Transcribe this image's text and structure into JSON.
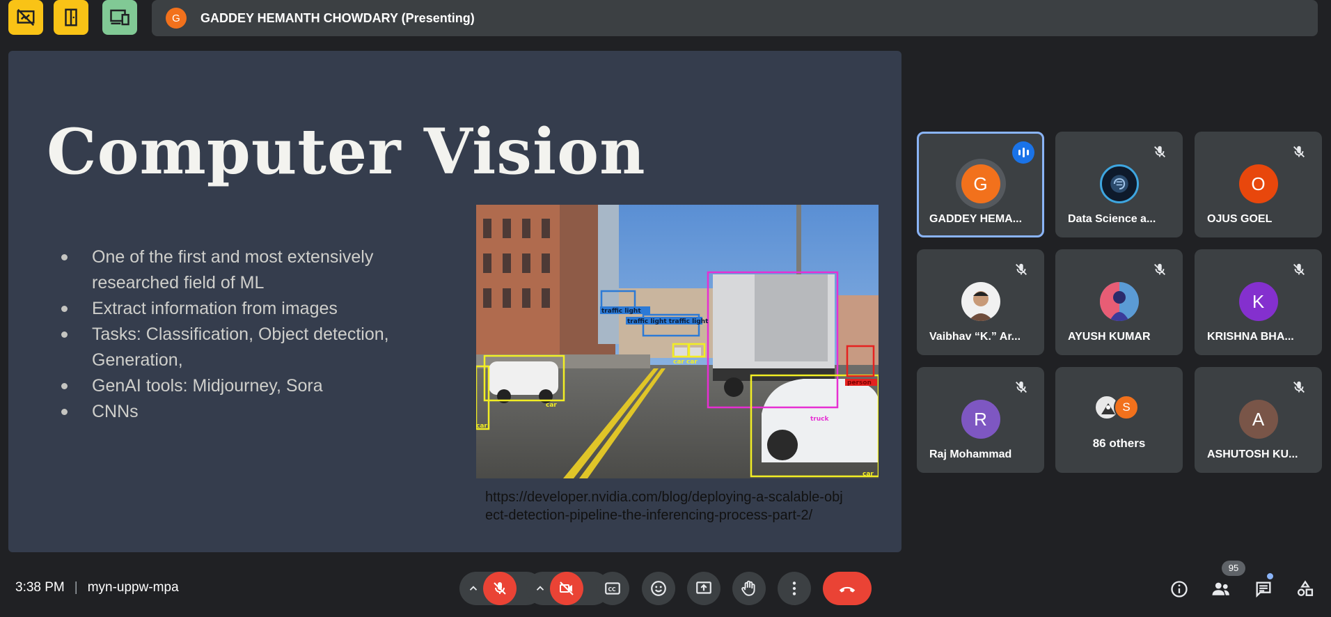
{
  "presenter_bar": {
    "avatar_letter": "G",
    "name": "GADDEY HEMANTH CHOWDARY (Presenting)"
  },
  "top_buttons": [
    {
      "icon": "hide-presentation-icon",
      "color": "#f9c316"
    },
    {
      "icon": "door-exit-icon",
      "color": "#f9c316"
    },
    {
      "icon": "devices-icon",
      "color": "#81c995"
    }
  ],
  "slide": {
    "title": "Computer Vision",
    "bullets": [
      "One of the first and most extensively researched field of ML",
      "Extract information from images",
      "Tasks: Classification, Object detection, Generation,",
      "GenAI tools: Midjourney, Sora",
      "CNNs"
    ],
    "image_labels": {
      "traffic_light_1": "traffic light",
      "traffic_light_2": "traffic light traffic light",
      "car_small": "car car",
      "car_left": "car",
      "car_left_edge": "car",
      "truck": "truck",
      "car_front": "car",
      "person": "person"
    },
    "caption_line1": "https://developer.nvidia.com/blog/deploying-a-scalable-obj",
    "caption_line2": "ect-detection-pipeline-the-inferencing-process-part-2/"
  },
  "participants": [
    {
      "name": "GADDEY HEMA...",
      "avatar": "G",
      "avatar_color": "#f2711c",
      "speaking": true
    },
    {
      "name": "Data Science a...",
      "avatar": "",
      "avatar_color": "#0e1a2b",
      "muted": true
    },
    {
      "name": "OJUS GOEL",
      "avatar": "O",
      "avatar_color": "#e8470c",
      "muted": true
    },
    {
      "name": "Vaibhav “K.” Ar...",
      "avatar": "",
      "avatar_color": "#f1f1f1",
      "muted": true
    },
    {
      "name": "AYUSH KUMAR",
      "avatar": "",
      "avatar_color": "#5b9bd5",
      "muted": true
    },
    {
      "name": "KRISHNA BHA...",
      "avatar": "K",
      "avatar_color": "#8430ce",
      "muted": true
    },
    {
      "name": "Raj Mohammad",
      "avatar": "R",
      "avatar_color": "#7e57c2",
      "muted": true
    },
    {
      "name": "86 others",
      "avatar": "S",
      "avatar_color": "#f2711c"
    },
    {
      "name": "ASHUTOSH KU...",
      "avatar": "A",
      "avatar_color": "#795548",
      "muted": true
    }
  ],
  "bottom": {
    "time": "3:38 PM",
    "separator": "|",
    "meeting_code": "myn-uppw-mpa",
    "people_count": "95"
  }
}
